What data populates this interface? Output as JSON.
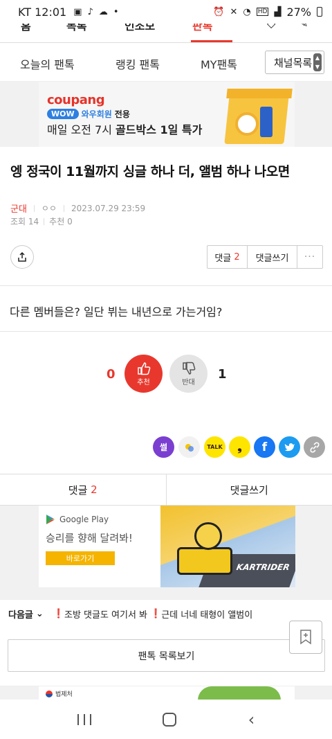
{
  "status_bar": {
    "carrier_time": "KT 12:01",
    "battery": "27%",
    "icons": [
      "image-icon",
      "tiktok-icon",
      "cloud-icon",
      "dot-icon",
      "alarm-icon",
      "mute-icon",
      "wifi-icon",
      "hd-icon",
      "signal-icon",
      "battery-icon"
    ]
  },
  "top_nav": {
    "items": [
      "홈",
      "목록",
      "인조모",
      "판톡"
    ],
    "active_index": 3
  },
  "sub_tabs": {
    "items": [
      "오늘의 팬톡",
      "랭킹 팬톡",
      "MY팬톡"
    ],
    "channel_button": "채널목록"
  },
  "coupang_ad": {
    "logo": "coupang",
    "wow": "WOW",
    "member": "와우회원",
    "only": "전용",
    "line1": "매일 오전 7시",
    "line1_bold": "골드박스 1일 특가"
  },
  "article": {
    "title": "엥 정국이 11월까지 싱글 하나 더, 앨범 하나 나오면",
    "author": "군대",
    "author_extra": "ㅇㅇ",
    "datetime": "2023.07.29 23:59",
    "views_label": "조회 14",
    "recommend_label": "추천 0",
    "body": "다른 멤버들은? 일단 뷔는 내년으로 가는거임?"
  },
  "comment_actions": {
    "comment_label": "댓글",
    "comment_count": "2",
    "write_label": "댓글쓰기",
    "more": "···"
  },
  "votes": {
    "up_count": "0",
    "up_label": "추천",
    "down_count": "1",
    "down_label": "반대"
  },
  "share": {
    "ssul_label": "썰",
    "talk_label": "TALK",
    "facebook_label": "f"
  },
  "comment_bar": {
    "comment_label": "댓글",
    "comment_count": "2",
    "write_label": "댓글쓰기"
  },
  "google_ad": {
    "brand": "Google Play",
    "headline": "승리를 향해 달려봐!",
    "cta": "바로가기",
    "game_logo": "KARTRIDER"
  },
  "next_article": {
    "label": "다음글",
    "items": [
      "조방 댓글도 여기서 봐",
      "근데 너네 태형이 앨범이"
    ]
  },
  "list_button": "팬톡 목록보기",
  "bottom_ad": {
    "brand": "법제처"
  },
  "colors": {
    "accent": "#e8382d",
    "facebook": "#1877f2",
    "twitter": "#1d9bf0",
    "kakao": "#fee500",
    "ssul": "#7a3fd0"
  }
}
